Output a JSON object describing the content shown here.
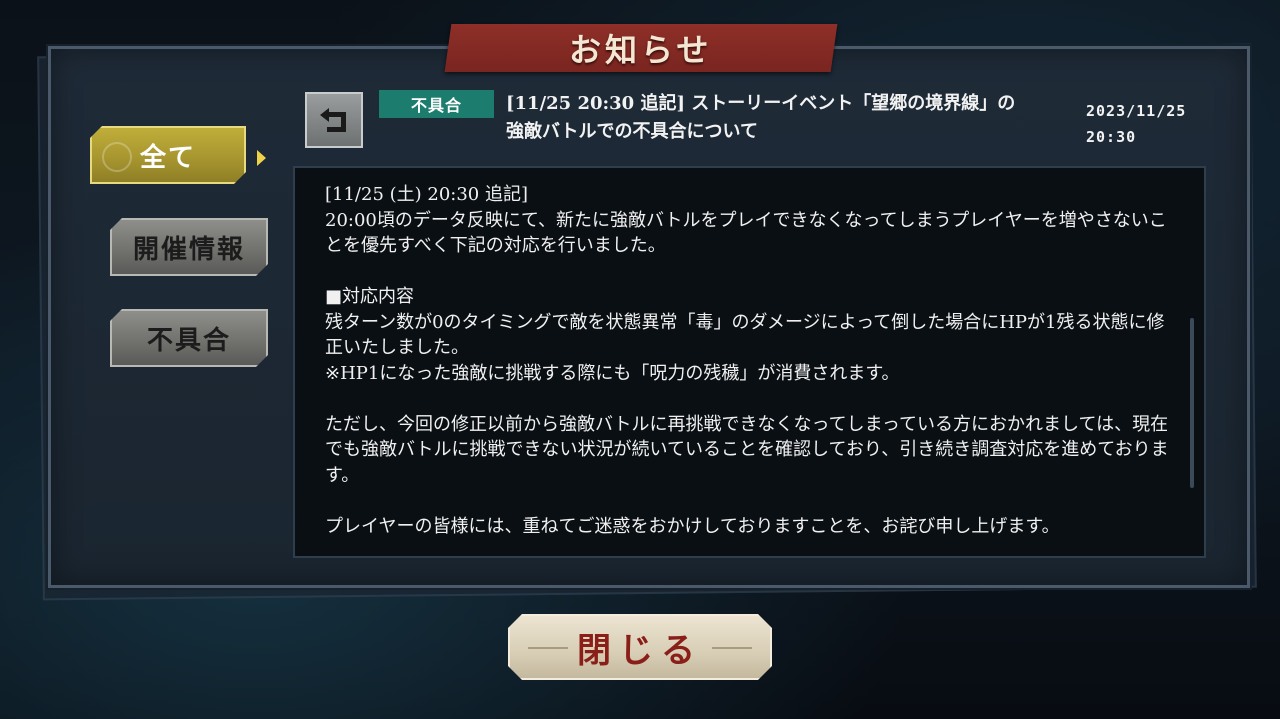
{
  "header": {
    "title": "お知らせ"
  },
  "sidebar": {
    "items": [
      {
        "label": "全て",
        "active": true
      },
      {
        "label": "開催情報",
        "active": false
      },
      {
        "label": "不具合",
        "active": false
      }
    ]
  },
  "notice": {
    "tag": "不具合",
    "title_line1": "[11/25 20:30 追記] ストーリーイベント「望郷の境界線」の",
    "title_line2": "強敵バトルでの不具合について",
    "date_line1": "2023/11/25",
    "date_line2": "20:30",
    "body": {
      "p1": "[11/25 (土) 20:30 追記]\n20:00頃のデータ反映にて、新たに強敵バトルをプレイできなくなってしまうプレイヤーを増やさないことを優先すべく下記の対応を行いました。",
      "p2": "■対応内容\n残ターン数が0のタイミングで敵を状態異常「毒」のダメージによって倒した場合にHPが1残る状態に修正いたしました。\n※HP1になった強敵に挑戦する際にも「呪力の残穢」が消費されます。",
      "p3": "ただし、今回の修正以前から強敵バトルに再挑戦できなくなってしまっている方におかれましては、現在でも強敵バトルに挑戦できない状況が続いていることを確認しており、引き続き調査対応を進めております。",
      "p4": "プレイヤーの皆様には、重ねてご迷惑をおかけしておりますことを、お詫び申し上げます。"
    }
  },
  "footer": {
    "close_label": "閉じる"
  },
  "colors": {
    "active_tab": "#a89630",
    "tag_bg": "#1c7d6e",
    "banner": "#8e2f28",
    "close_text": "#8a1f1a"
  },
  "icons": {
    "back": "back-arrow-icon",
    "active_pointer": "triangle-right-icon"
  }
}
